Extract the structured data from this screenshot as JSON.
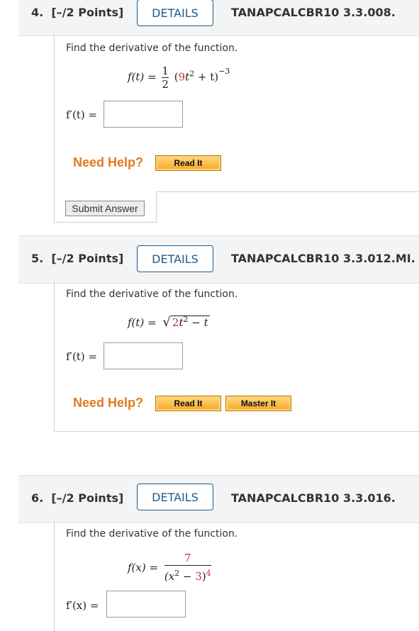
{
  "q4": {
    "number": "4.",
    "points": "[–/2 Points]",
    "details_label": "DETAILS",
    "code": "TANAPCALCBR10 3.3.008.",
    "prompt": "Find the derivative of the function.",
    "func_lhs": "f(t) =",
    "frac_num": "1",
    "frac_den": "2",
    "expr_open": "(",
    "coef": "9",
    "var": "t",
    "exp2": "2",
    "plus_t": " + t)",
    "exp_neg3": "−3",
    "answer_label": "f′(t) =",
    "need_help": "Need Help?",
    "read_it": "Read It",
    "submit": "Submit Answer"
  },
  "q5": {
    "number": "5.",
    "points": "[–/2 Points]",
    "details_label": "DETAILS",
    "code": "TANAPCALCBR10 3.3.012.MI.",
    "prompt": "Find the derivative of the function.",
    "func_lhs": "f(t) =",
    "sqrt_sign": "√",
    "radicand_coef": "2",
    "radicand_var": "t",
    "radicand_exp": "2",
    "radicand_rest": " − t",
    "answer_label": "f′(t) =",
    "need_help": "Need Help?",
    "read_it": "Read It",
    "master_it": "Master It"
  },
  "q6": {
    "number": "6.",
    "points": "[–/2 Points]",
    "details_label": "DETAILS",
    "code": "TANAPCALCBR10 3.3.016.",
    "prompt": "Find the derivative of the function.",
    "func_lhs": "f(x) =",
    "numerator": "7",
    "den_open": "(x",
    "den_exp2": "2",
    "den_minus": " − ",
    "den_3": "3",
    "den_close": ")",
    "den_exp4": "4",
    "answer_label": "f′(x) ="
  },
  "colors": {
    "accent": "#1f5b8a",
    "help_orange": "#e07a1f",
    "math_red": "#c0392b"
  }
}
